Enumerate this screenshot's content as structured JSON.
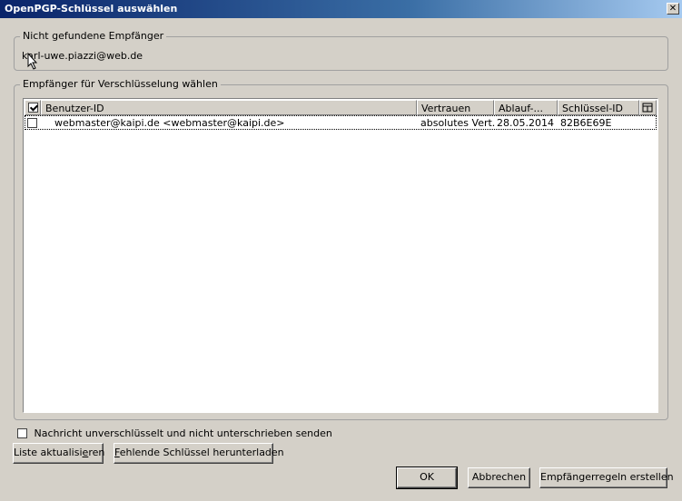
{
  "window": {
    "title": "OpenPGP-Schlüssel auswählen",
    "close_glyph": "✕"
  },
  "missing": {
    "legend": "Nicht gefundene Empfänger",
    "address": "karl-uwe.piazzi@web.de"
  },
  "recipients": {
    "legend": "Empfänger für Verschlüsselung wählen",
    "columns": {
      "user_id": "Benutzer-ID",
      "trust": "Vertrauen",
      "expiry": "Ablauf-...",
      "key_id": "Schlüssel-ID"
    },
    "rows": [
      {
        "checked": false,
        "user_id": "webmaster@kaipi.de <webmaster@kaipi.de>",
        "trust": "absolutes Vert...",
        "expiry": "28.05.2014",
        "key_id": "82B6E69E"
      }
    ]
  },
  "options": {
    "send_unencrypted_label": "Nachricht unverschlüsselt und nicht unterschrieben senden",
    "send_unencrypted_checked": false
  },
  "buttons": {
    "refresh_pre": "Liste aktualisi",
    "refresh_key": "e",
    "refresh_post": "ren",
    "download_key": "F",
    "download_post": "ehlende Schlüssel herunterladen",
    "ok": "OK",
    "cancel": "Abbrechen",
    "rules": "Empfängerregeln erstellen"
  }
}
